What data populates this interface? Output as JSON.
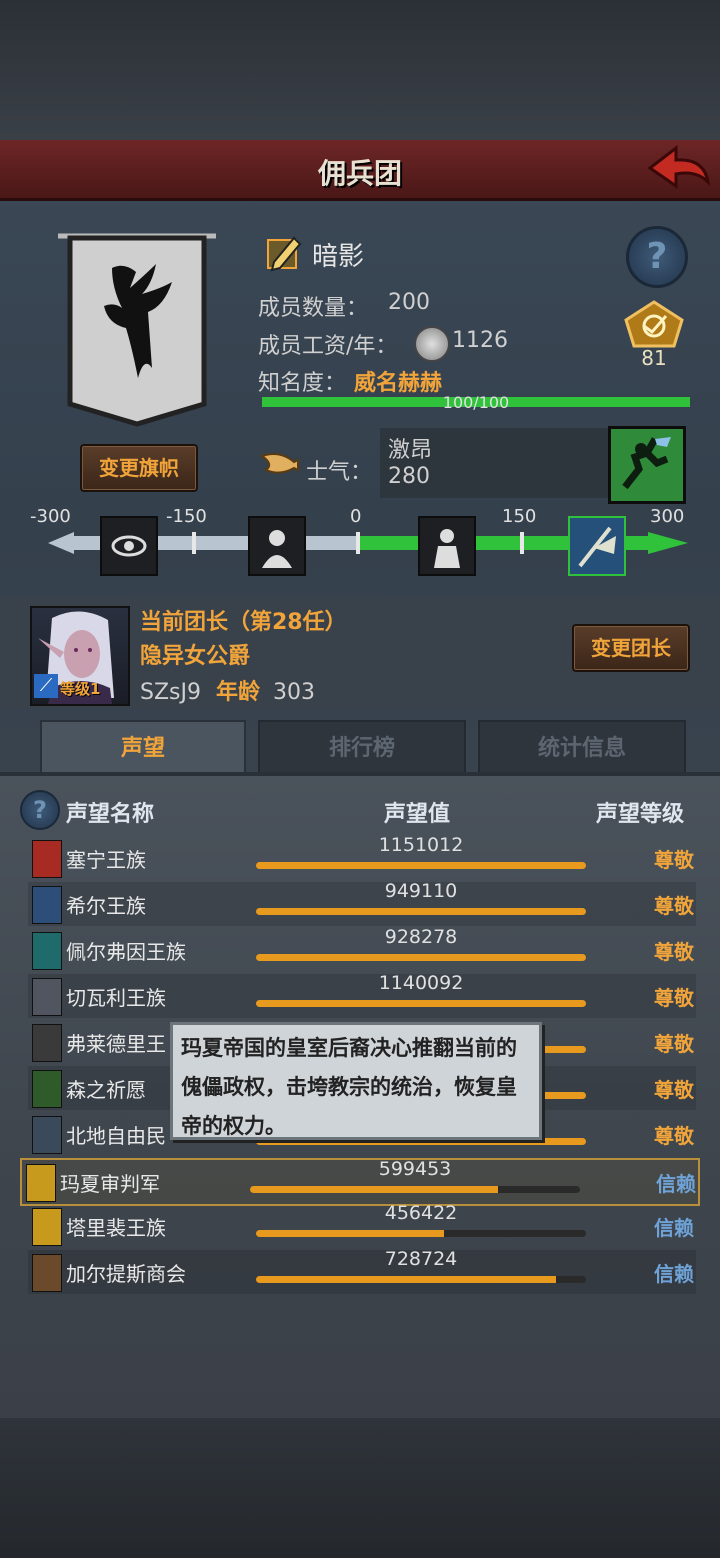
{
  "header": {
    "title": "佣兵团"
  },
  "guild": {
    "name": "暗影",
    "members_label": "成员数量：",
    "members_value": "200",
    "salary_label": "成员工资/年：",
    "salary_value": "1126",
    "fame_label": "知名度：",
    "fame_value": "威名赫赫",
    "fame_progress_text": "100/100",
    "fame_progress": 1.0,
    "rank_badge": "81",
    "change_banner_label": "变更旗帜"
  },
  "morale": {
    "label": "士气：",
    "state": "激昂",
    "value": "280",
    "scale_min": -300,
    "scale_max": 300,
    "ticks": [
      "-300",
      "-150",
      "0",
      "150",
      "300"
    ],
    "current": 280
  },
  "leader": {
    "title": "当前团长（第28任）",
    "name": "隐异女公爵",
    "id_age": "SZsJ9",
    "age_label": "年龄",
    "age_value": "303",
    "level_text": "等级1",
    "change_label": "变更团长"
  },
  "tabs": [
    {
      "label": "声望"
    },
    {
      "label": "排行榜"
    },
    {
      "label": "统计信息"
    }
  ],
  "table": {
    "col_name": "声望名称",
    "col_value": "声望值",
    "col_level": "声望等级",
    "rows": [
      {
        "name": "塞宁王族",
        "value": "1151012",
        "fill": 1.0,
        "level": "尊敬",
        "color": "#a72b22"
      },
      {
        "name": "希尔王族",
        "value": "949110",
        "fill": 1.0,
        "level": "尊敬",
        "color": "#2c4e78"
      },
      {
        "name": "佩尔弗因王族",
        "value": "928278",
        "fill": 1.0,
        "level": "尊敬",
        "color": "#1f6a6a"
      },
      {
        "name": "切瓦利王族",
        "value": "1140092",
        "fill": 1.0,
        "level": "尊敬",
        "color": "#505560"
      },
      {
        "name": "弗莱德里王",
        "value": "",
        "fill": 1.0,
        "level": "尊敬",
        "color": "#3a3a3a"
      },
      {
        "name": "森之祈愿",
        "value": "",
        "fill": 1.0,
        "level": "尊敬",
        "color": "#2f5a2a"
      },
      {
        "name": "北地自由民",
        "value": "",
        "fill": 1.0,
        "level": "尊敬",
        "color": "#3a4a5a"
      },
      {
        "name": "玛夏审判军",
        "value": "599453",
        "fill": 0.75,
        "level": "信赖",
        "color": "#c79a1e"
      },
      {
        "name": "塔里裴王族",
        "value": "456422",
        "fill": 0.57,
        "level": "信赖",
        "color": "#c79a1e"
      },
      {
        "name": "加尔提斯商会",
        "value": "728724",
        "fill": 0.91,
        "level": "信赖",
        "color": "#6a4a2a"
      }
    ]
  },
  "tooltip": {
    "text": "玛夏帝国的皇室后裔决心推翻当前的傀儡政权，击垮教宗的统治，恢复皇帝的权力。"
  },
  "colors": {
    "accent": "#f0a43a",
    "level_respect": "#f0a43a",
    "level_trust": "#6fa3d8",
    "bar_green": "#2fc23a",
    "bar_orange": "#e89a1e"
  }
}
